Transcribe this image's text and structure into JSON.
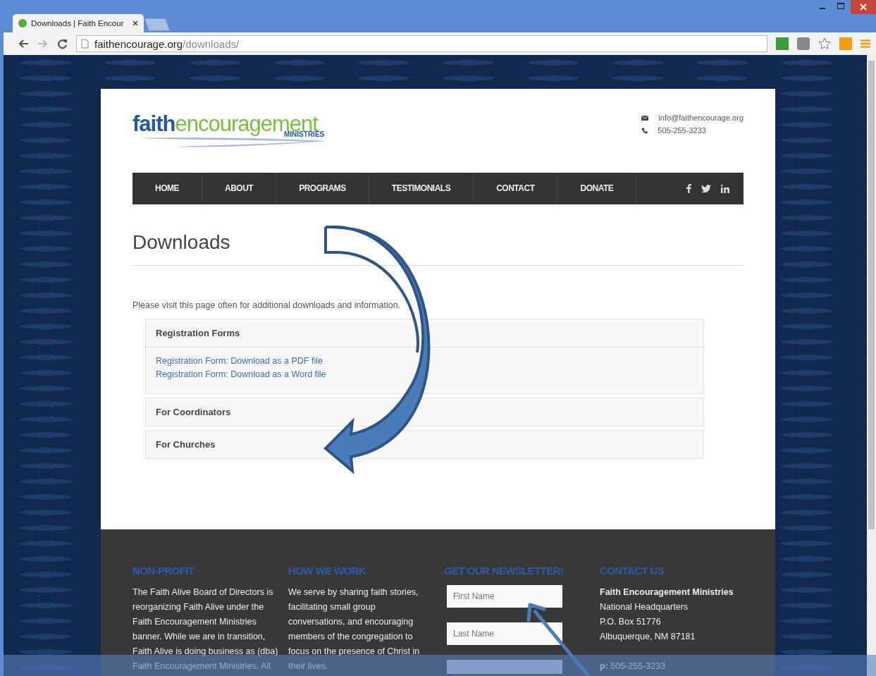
{
  "browser": {
    "tab_title": "Downloads | Faith Encour",
    "url_domain": "faithencourage.org",
    "url_path": "/downloads/"
  },
  "header": {
    "logo": {
      "part_1": "faith",
      "part_2": "encouragement",
      "part_3": "MINISTRIES"
    },
    "contacts": [
      {
        "kind": "email",
        "text": "info@faithencourage.org"
      },
      {
        "kind": "phone",
        "text": "505-255-3233"
      }
    ]
  },
  "nav": {
    "items": [
      "HOME",
      "ABOUT",
      "PROGRAMS",
      "TESTIMONIALS",
      "CONTACT",
      "DONATE"
    ]
  },
  "page": {
    "title": "Downloads",
    "intro": "Please visit this page often for additional downloads and information.",
    "sections": [
      {
        "title": "Registration Forms",
        "expanded": true,
        "links": [
          "Registration Form: Download as a PDF file",
          "Registration Form: Download as a Word file"
        ]
      },
      {
        "title": "For Coordinators",
        "expanded": false
      },
      {
        "title": "For Churches",
        "expanded": false
      }
    ]
  },
  "footer": {
    "columns": [
      {
        "kind": "text",
        "heading": "NON-PROFIT",
        "text": "The Faith Alive Board of Directors is reorganizing Faith Alive under the Faith Encouragement Ministries banner. While we are in transition, Faith Alive is doing business as (dba) Faith Encouragement Ministries. All"
      },
      {
        "kind": "text",
        "heading": "HOW WE WORK",
        "text": "We serve by sharing faith stories, facilitating small group conversations, and encouraging members of the congregation to focus on the presence of Christ in their lives."
      },
      {
        "kind": "form",
        "heading": "GET OUR NEWSLETTER!",
        "fields": [
          {
            "placeholder": "First Name"
          },
          {
            "placeholder": "Last Name"
          }
        ]
      },
      {
        "kind": "contact",
        "heading": "CONTACT US",
        "name": "Faith Encouragement Ministries",
        "lines": [
          "National Headquarters",
          "P.O. Box 51776",
          "Albuquerque, NM 87181"
        ],
        "phone": "**p:** 505-255-3233"
      }
    ]
  }
}
